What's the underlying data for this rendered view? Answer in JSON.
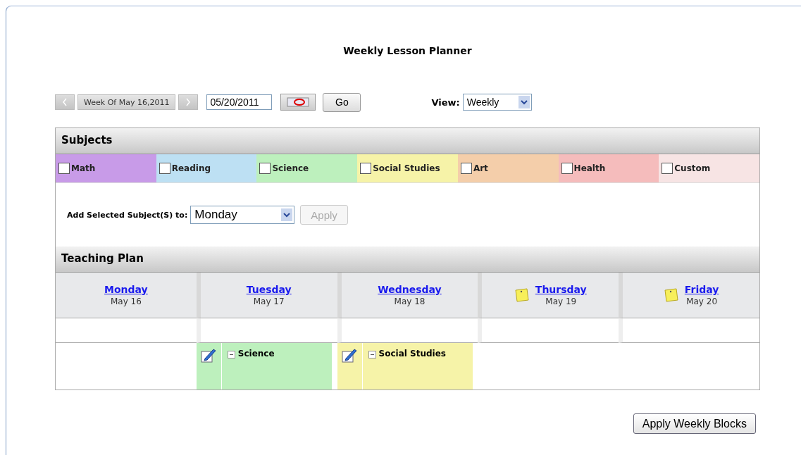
{
  "title": "Weekly Lesson Planner",
  "toolbar": {
    "week_label": "Week Of May 16,2011",
    "date": "05/20/2011",
    "go": "Go",
    "view_label": "View:",
    "view_value": "Weekly"
  },
  "subjects": {
    "title": "Subjects",
    "items": [
      {
        "label": "Math",
        "checked": false,
        "color": "#c89be8"
      },
      {
        "label": "Reading",
        "checked": false,
        "color": "#bde0f3"
      },
      {
        "label": "Science",
        "checked": false,
        "color": "#bdf0bd"
      },
      {
        "label": "Social Studies",
        "checked": false,
        "color": "#f6f3a8"
      },
      {
        "label": "Art",
        "checked": false,
        "color": "#f4ceaa"
      },
      {
        "label": "Health",
        "checked": false,
        "color": "#f5bcbc"
      },
      {
        "label": "Custom",
        "checked": false,
        "color": "#f7e4e4"
      }
    ],
    "add_label": "Add Selected Subject(S) to:",
    "add_day": "Monday",
    "apply": "Apply",
    "apply_disabled": true
  },
  "teaching_plan": {
    "title": "Teaching Plan",
    "days": [
      {
        "name": "Monday",
        "date": "May 16",
        "note": false
      },
      {
        "name": "Tuesday",
        "date": "May 17",
        "note": false,
        "entries": [
          {
            "subject": "Science",
            "color": "#bdf0bd"
          }
        ]
      },
      {
        "name": "Wednesday",
        "date": "May 18",
        "note": false,
        "entries": [
          {
            "subject": "Social Studies",
            "color": "#f6f3a8"
          }
        ]
      },
      {
        "name": "Thursday",
        "date": "May 19",
        "note": true
      },
      {
        "name": "Friday",
        "date": "May 20",
        "note": true
      }
    ]
  },
  "apply_weekly": "Apply Weekly Blocks"
}
